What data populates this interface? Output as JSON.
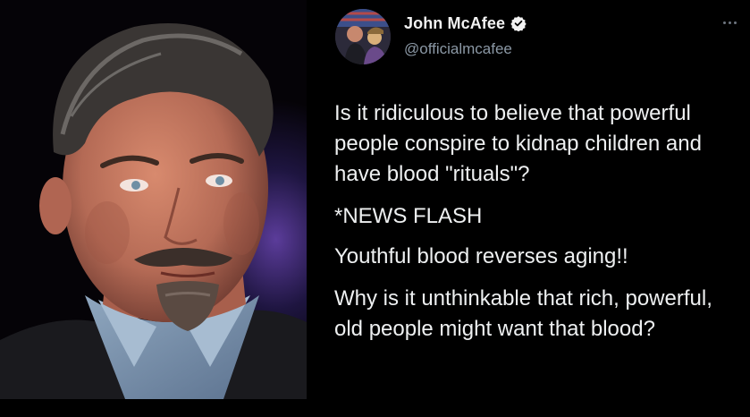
{
  "tweet": {
    "display_name": "John McAfee",
    "handle": "@officialmcafee",
    "verified": true,
    "more_icon": "more-horizontal-icon",
    "paragraphs": [
      "Is it ridiculous to believe that powerful people conspire to kidnap children and have blood \"rituals\"?",
      "*NEWS FLASH",
      "Youthful blood reverses aging!!",
      "Why is it unthinkable that rich, powerful, old people might want that blood?"
    ]
  },
  "colors": {
    "background": "#000000",
    "text": "#e7e9ea",
    "handle": "#8b98a5",
    "verified_badge": "#f2f2f2"
  }
}
